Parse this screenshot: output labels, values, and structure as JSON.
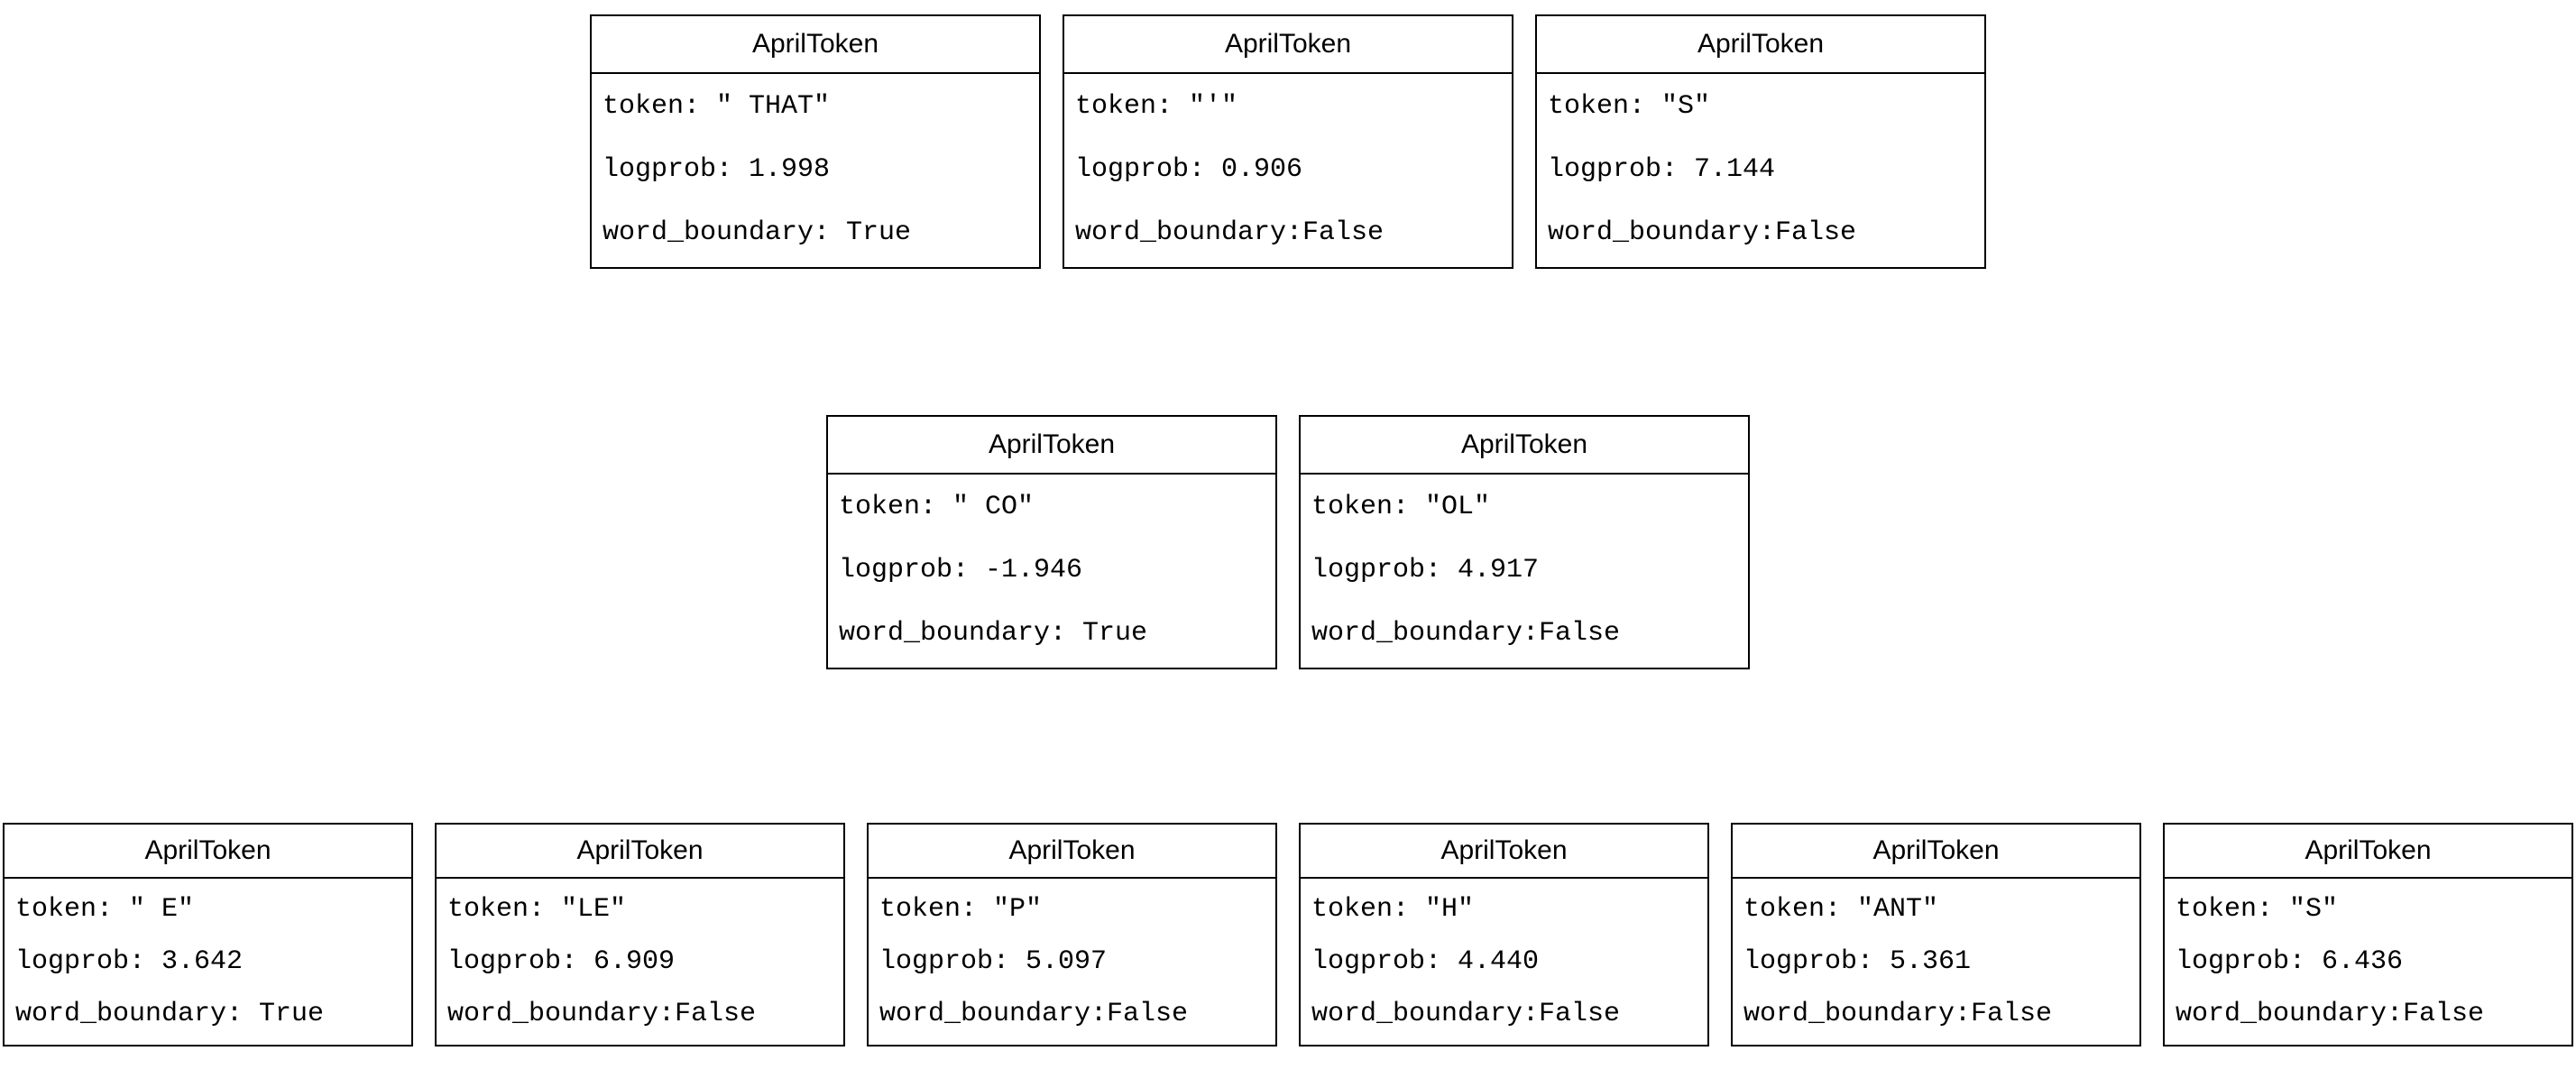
{
  "header_label": "AprilToken",
  "field_labels": {
    "token": "token: ",
    "logprob": "logprob: ",
    "word_boundary_true": "word_boundary: True",
    "word_boundary_false": "word_boundary:False"
  },
  "rows": [
    {
      "tokens": [
        {
          "token": "\" THAT\"",
          "logprob": "1.998",
          "word_boundary": true
        },
        {
          "token": "\"'\"",
          "logprob": "0.906",
          "word_boundary": false
        },
        {
          "token": "\"S\"",
          "logprob": "7.144",
          "word_boundary": false
        }
      ]
    },
    {
      "tokens": [
        {
          "token": "\" CO\"",
          "logprob": "-1.946",
          "word_boundary": true
        },
        {
          "token": "\"OL\"",
          "logprob": "4.917",
          "word_boundary": false
        }
      ]
    },
    {
      "tokens": [
        {
          "token": "\" E\"",
          "logprob": "3.642",
          "word_boundary": true
        },
        {
          "token": "\"LE\"",
          "logprob": "6.909",
          "word_boundary": false
        },
        {
          "token": "\"P\"",
          "logprob": "5.097",
          "word_boundary": false
        },
        {
          "token": "\"H\"",
          "logprob": "4.440",
          "word_boundary": false
        },
        {
          "token": "\"ANT\"",
          "logprob": "5.361",
          "word_boundary": false
        },
        {
          "token": "\"S\"",
          "logprob": "6.436",
          "word_boundary": false
        }
      ]
    }
  ]
}
